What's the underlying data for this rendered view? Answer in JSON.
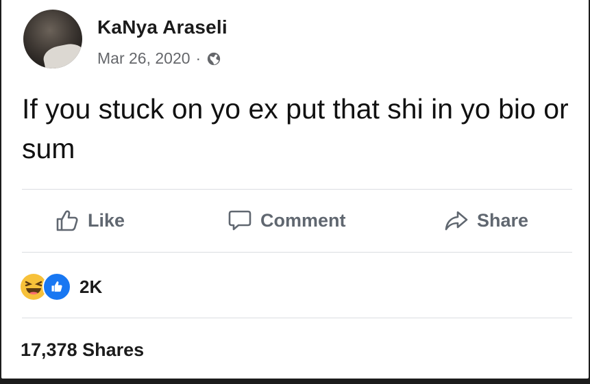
{
  "post": {
    "author": "KaNya Araseli",
    "date": "Mar 26, 2020",
    "separator": "·",
    "audience_icon": "globe-icon",
    "text": "If you stuck on yo ex put that shi in yo bio or sum"
  },
  "actions": {
    "like_label": "Like",
    "comment_label": "Comment",
    "share_label": "Share"
  },
  "reactions": {
    "icons": [
      "haha-reaction-icon",
      "like-reaction-icon"
    ],
    "count": "2K"
  },
  "shares_text": "17,378 Shares",
  "colors": {
    "like_blue": "#1877f2",
    "haha_yellow": "#f7c13a",
    "secondary_text": "#65676b"
  }
}
